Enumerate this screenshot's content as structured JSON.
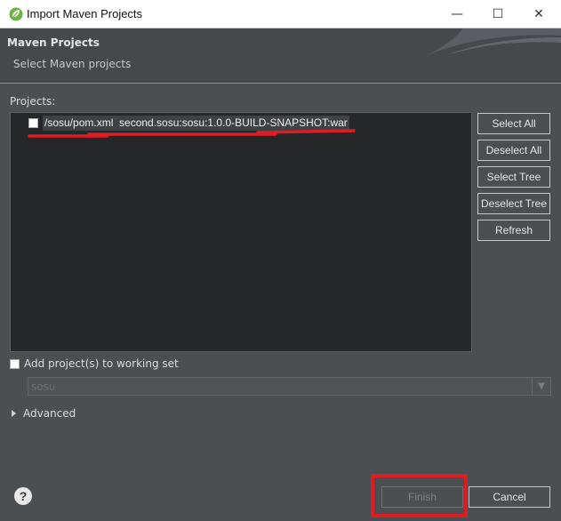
{
  "window": {
    "title": "Import Maven Projects",
    "minimize": "—",
    "maximize": "☐",
    "close": "✕"
  },
  "header": {
    "title": "Maven Projects",
    "subtitle": "Select Maven projects"
  },
  "projects": {
    "label": "Projects:",
    "items": [
      {
        "path": "/sosu/pom.xml",
        "artifact": "second.sosu:sosu:1.0.0-BUILD-SNAPSHOT:war",
        "checked": false
      }
    ]
  },
  "buttons": {
    "select_all": "Select All",
    "deselect_all": "Deselect All",
    "select_tree": "Select Tree",
    "deselect_tree": "Deselect Tree",
    "refresh": "Refresh"
  },
  "working_set": {
    "label": "Add project(s) to working set",
    "checked": false,
    "value": "sosu"
  },
  "advanced": {
    "label": "Advanced"
  },
  "footer": {
    "help": "?",
    "finish": "Finish",
    "cancel": "Cancel"
  },
  "colors": {
    "background": "#4b4f52",
    "annotation_red": "#e01b24",
    "tree_bg": "#262728"
  }
}
